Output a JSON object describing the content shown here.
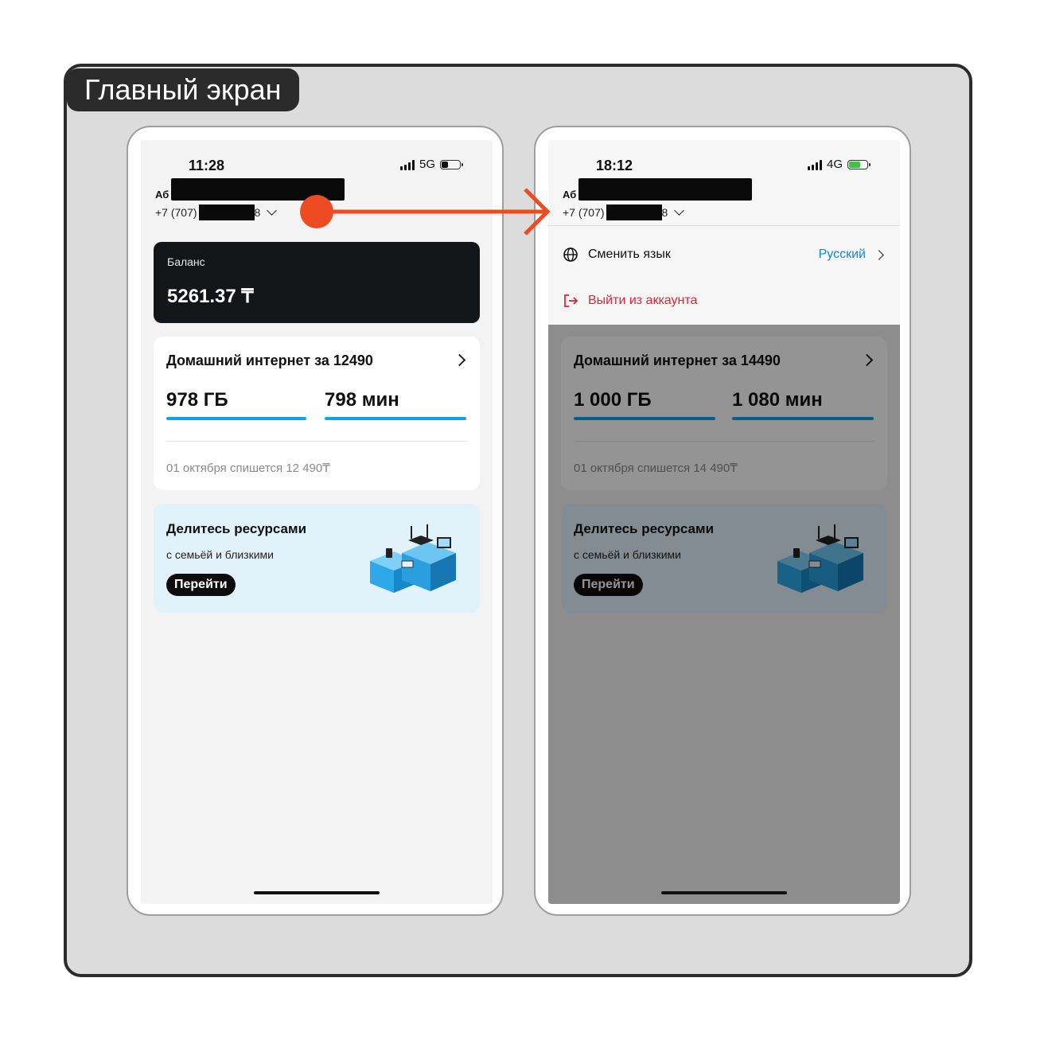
{
  "board": {
    "title": "Главный экран"
  },
  "left": {
    "status": {
      "time": "11:28",
      "network": "5G"
    },
    "user": {
      "name_prefix": "Аб",
      "phone_prefix": "+7 (707)",
      "phone_suffix": "8"
    },
    "balance": {
      "label": "Баланс",
      "value": "5261.37 ₸"
    },
    "plan": {
      "title": "Домашний интернет за 12490",
      "data": "978 ГБ",
      "minutes": "798 мин",
      "data_fraction": 0.99,
      "minutes_fraction": 1.0,
      "note": "01 октября спишется 12 490₸"
    },
    "share": {
      "title": "Делитесь ресурсами",
      "subtitle": "с семьёй и близкими",
      "button": "Перейти"
    }
  },
  "right": {
    "status": {
      "time": "18:12",
      "network": "4G"
    },
    "user": {
      "name_prefix": "Аб",
      "phone_prefix": "+7 (707)",
      "phone_suffix": "8"
    },
    "menu": {
      "language_label": "Сменить язык",
      "language_value": "Русский",
      "logout_label": "Выйти из аккаунта"
    },
    "plan": {
      "title": "Домашний интернет за 14490",
      "data": "1 000 ГБ",
      "minutes": "1 080 мин",
      "note": "01 октября спишется 14 490₸"
    },
    "share": {
      "title": "Делитесь ресурсами",
      "subtitle": "с семьёй и близкими",
      "button": "Перейти"
    }
  },
  "colors": {
    "accent_blue": "#0aa3f0",
    "arrow": "#ef4b23",
    "logout": "#e2233b",
    "link": "#1a84dc"
  },
  "icons": [
    "signal-icon",
    "battery-icon",
    "chevron-down-icon",
    "chevron-right-icon",
    "globe-icon",
    "logout-icon"
  ]
}
